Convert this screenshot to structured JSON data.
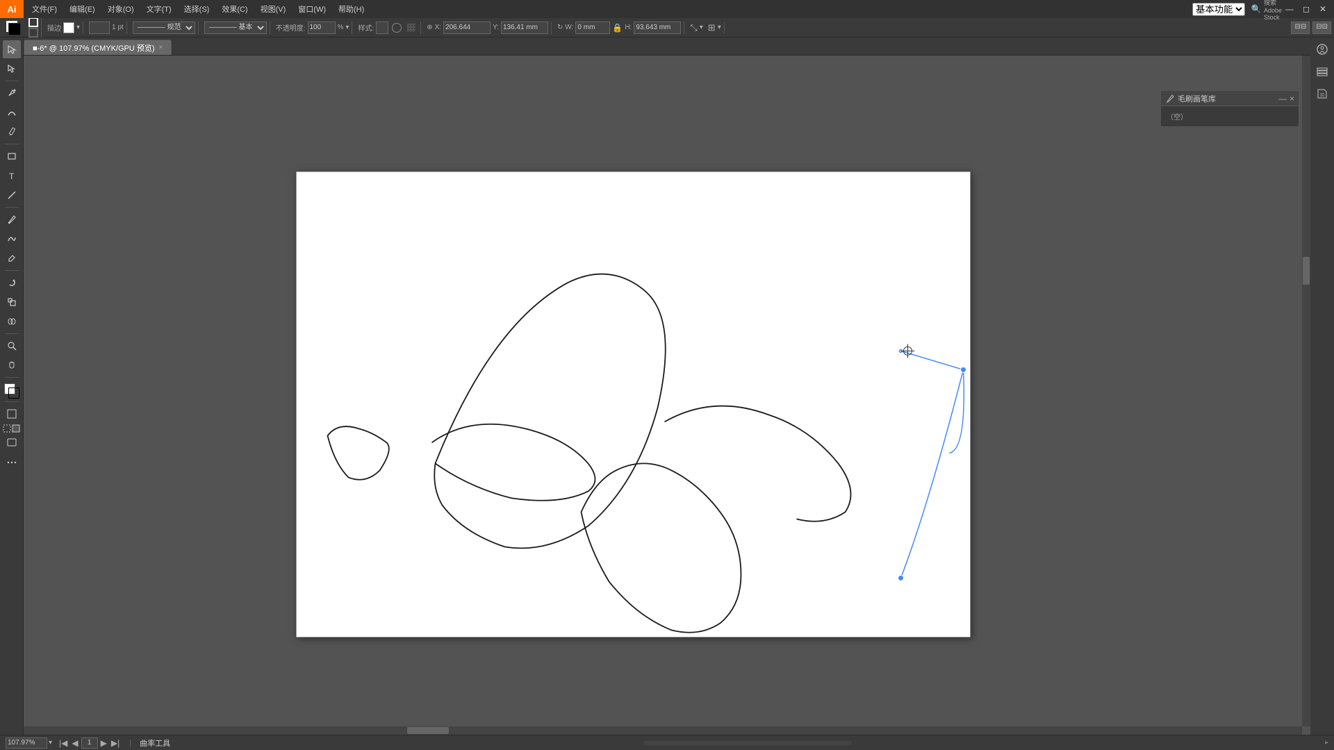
{
  "app": {
    "logo": "Ai",
    "title": "Adobe Illustrator",
    "workspace": "基本功能"
  },
  "menu": {
    "items": [
      "文件(F)",
      "编辑(E)",
      "对象(O)",
      "文字(T)",
      "选择(S)",
      "效果(C)",
      "视图(V)",
      "窗口(W)",
      "帮助(H)"
    ]
  },
  "toolbar": {
    "stroke_label": "描边",
    "stroke_width": "1 pt",
    "stroke_style": "————  规范",
    "stroke_type": "————  基本",
    "opacity_label": "不透明度:",
    "opacity_value": "100",
    "style_label": "样式:",
    "x_label": "X:",
    "x_value": "206.644",
    "y_label": "Y:",
    "y_value": "136.41 mm",
    "w_label": "W:",
    "w_value": "0 mm",
    "h_label": "H:",
    "h_value": "93.643 mm"
  },
  "tab": {
    "label": "■-6* @ 107.97% (CMYK/GPU 预览)",
    "close": "×"
  },
  "statusbar": {
    "zoom": "107.97%",
    "page": "1",
    "tool_label": "曲率工具"
  },
  "float_panel": {
    "title": "毛刷画笔库",
    "minimize": "—",
    "close": "×"
  },
  "right_panel": {
    "icons": [
      "properties",
      "layers",
      "libraries"
    ]
  },
  "canvas": {
    "has_drawing": true
  }
}
